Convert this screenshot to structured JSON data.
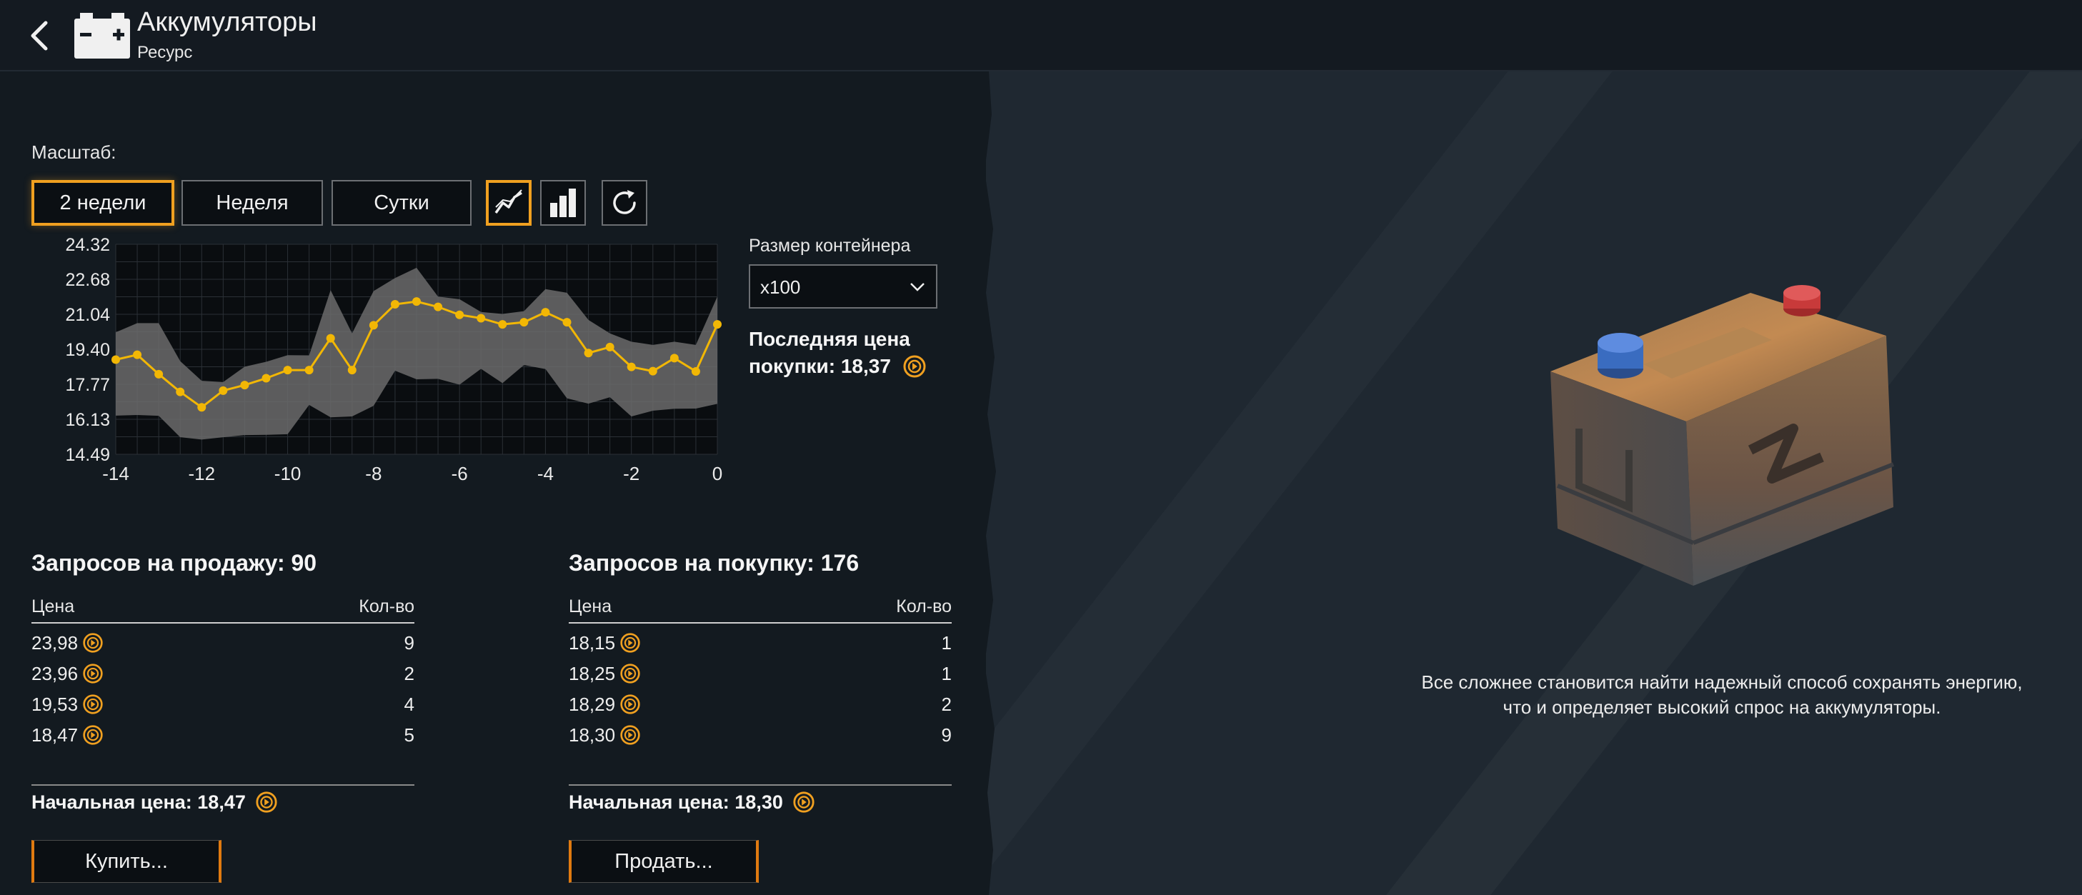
{
  "header": {
    "title": "Аккумуляторы",
    "subtitle": "Ресурс"
  },
  "scale": {
    "label": "Масштаб:",
    "buttons": [
      "2 недели",
      "Неделя",
      "Сутки"
    ],
    "active": "2 недели"
  },
  "container": {
    "label": "Размер контейнера",
    "value": "x100"
  },
  "last_price": {
    "line1": "Последняя цена",
    "line2": "покупки: 18,37"
  },
  "chart_data": {
    "type": "line",
    "x": [
      -14,
      -13.5,
      -13,
      -12.5,
      -12,
      -11.5,
      -11,
      -10.5,
      -10,
      -9.5,
      -9,
      -8.5,
      -8,
      -7.5,
      -7,
      -6.5,
      -6,
      -5.5,
      -5,
      -4.5,
      -4,
      -3.5,
      -3,
      -2.5,
      -2,
      -1.5,
      -1,
      -0.5,
      0
    ],
    "series": [
      {
        "values": [
          18.92,
          19.15,
          18.24,
          17.41,
          16.69,
          17.47,
          17.73,
          18.05,
          18.43,
          18.43,
          19.92,
          18.43,
          20.53,
          21.51,
          21.64,
          21.39,
          21.02,
          20.86,
          20.57,
          20.67,
          21.14,
          20.67,
          19.23,
          19.51,
          18.58,
          18.38,
          18.99,
          18.37,
          20.57
        ]
      }
    ],
    "band_upper": [
      20.2,
      20.63,
      20.63,
      18.85,
      17.93,
      17.87,
      18.59,
      18.82,
      19.13,
      19.12,
      22.17,
      20.15,
      22.13,
      22.74,
      23.22,
      21.87,
      21.75,
      21.15,
      21.06,
      21.19,
      22.22,
      22.05,
      20.78,
      20.15,
      19.76,
      19.61,
      19.76,
      19.61,
      21.87
    ],
    "band_lower": [
      16.3,
      16.33,
      16.29,
      15.29,
      15.18,
      15.29,
      15.39,
      15.4,
      15.43,
      16.8,
      16.22,
      16.26,
      16.76,
      18.4,
      18.0,
      18.02,
      17.75,
      18.49,
      17.82,
      18.67,
      18.48,
      17.11,
      16.86,
      17.16,
      16.26,
      16.53,
      16.62,
      16.63,
      16.85
    ],
    "ylim": [
      14.49,
      24.32
    ],
    "yticks": [
      "24.32",
      "22.68",
      "21.04",
      "19.40",
      "17.77",
      "16.13",
      "14.49"
    ],
    "xticks": [
      "-14",
      "-12",
      "-10",
      "-8",
      "-6",
      "-4",
      "-2",
      "0"
    ],
    "grid": true,
    "colors": {
      "line": "#f2b705",
      "band": "#6b6b6b",
      "background": "#0a0d10",
      "grid": "#2b3036"
    }
  },
  "sell": {
    "title": "Запросов на продажу: 90",
    "col_price": "Цена",
    "col_qty": "Кол-во",
    "rows": [
      {
        "price": "23,98",
        "qty": "9"
      },
      {
        "price": "23,96",
        "qty": "2"
      },
      {
        "price": "19,53",
        "qty": "4"
      },
      {
        "price": "18,47",
        "qty": "5"
      }
    ],
    "start_price": "Начальная цена: 18,47",
    "button": "Купить..."
  },
  "buy": {
    "title": "Запросов на покупку: 176",
    "col_price": "Цена",
    "col_qty": "Кол-во",
    "rows": [
      {
        "price": "18,15",
        "qty": "1"
      },
      {
        "price": "18,25",
        "qty": "1"
      },
      {
        "price": "18,29",
        "qty": "2"
      },
      {
        "price": "18,30",
        "qty": "9"
      }
    ],
    "start_price": "Начальная цена: 18,30",
    "button": "Продать..."
  },
  "description": {
    "line1": "Все сложнее становится найти надежный способ сохранять энергию,",
    "line2": "что и определяет высокий спрос на аккумуляторы."
  },
  "icons": {
    "coin": "coin-icon",
    "accent": "#f0a020"
  }
}
